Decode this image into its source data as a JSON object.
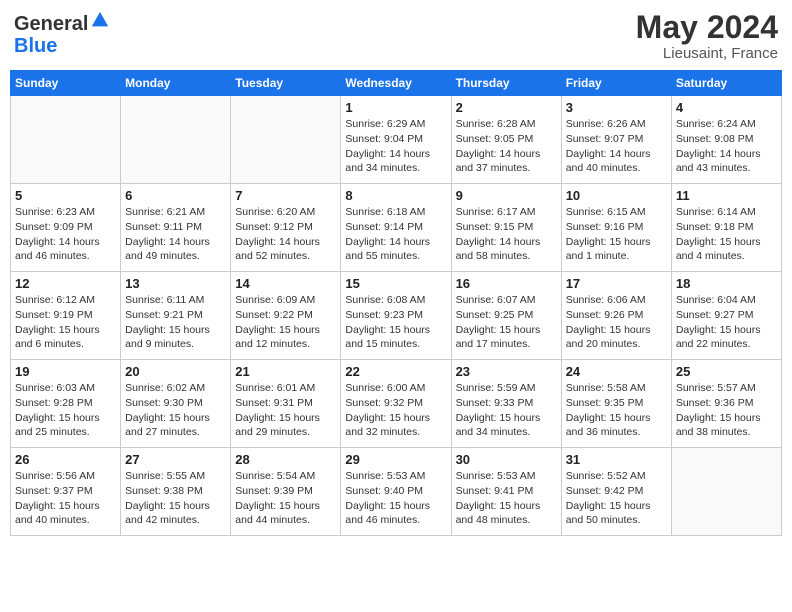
{
  "header": {
    "logo_general": "General",
    "logo_blue": "Blue",
    "month": "May 2024",
    "location": "Lieusaint, France"
  },
  "weekdays": [
    "Sunday",
    "Monday",
    "Tuesday",
    "Wednesday",
    "Thursday",
    "Friday",
    "Saturday"
  ],
  "weeks": [
    [
      {
        "day": "",
        "sunrise": "",
        "sunset": "",
        "daylight": ""
      },
      {
        "day": "",
        "sunrise": "",
        "sunset": "",
        "daylight": ""
      },
      {
        "day": "",
        "sunrise": "",
        "sunset": "",
        "daylight": ""
      },
      {
        "day": "1",
        "sunrise": "Sunrise: 6:29 AM",
        "sunset": "Sunset: 9:04 PM",
        "daylight": "Daylight: 14 hours and 34 minutes."
      },
      {
        "day": "2",
        "sunrise": "Sunrise: 6:28 AM",
        "sunset": "Sunset: 9:05 PM",
        "daylight": "Daylight: 14 hours and 37 minutes."
      },
      {
        "day": "3",
        "sunrise": "Sunrise: 6:26 AM",
        "sunset": "Sunset: 9:07 PM",
        "daylight": "Daylight: 14 hours and 40 minutes."
      },
      {
        "day": "4",
        "sunrise": "Sunrise: 6:24 AM",
        "sunset": "Sunset: 9:08 PM",
        "daylight": "Daylight: 14 hours and 43 minutes."
      }
    ],
    [
      {
        "day": "5",
        "sunrise": "Sunrise: 6:23 AM",
        "sunset": "Sunset: 9:09 PM",
        "daylight": "Daylight: 14 hours and 46 minutes."
      },
      {
        "day": "6",
        "sunrise": "Sunrise: 6:21 AM",
        "sunset": "Sunset: 9:11 PM",
        "daylight": "Daylight: 14 hours and 49 minutes."
      },
      {
        "day": "7",
        "sunrise": "Sunrise: 6:20 AM",
        "sunset": "Sunset: 9:12 PM",
        "daylight": "Daylight: 14 hours and 52 minutes."
      },
      {
        "day": "8",
        "sunrise": "Sunrise: 6:18 AM",
        "sunset": "Sunset: 9:14 PM",
        "daylight": "Daylight: 14 hours and 55 minutes."
      },
      {
        "day": "9",
        "sunrise": "Sunrise: 6:17 AM",
        "sunset": "Sunset: 9:15 PM",
        "daylight": "Daylight: 14 hours and 58 minutes."
      },
      {
        "day": "10",
        "sunrise": "Sunrise: 6:15 AM",
        "sunset": "Sunset: 9:16 PM",
        "daylight": "Daylight: 15 hours and 1 minute."
      },
      {
        "day": "11",
        "sunrise": "Sunrise: 6:14 AM",
        "sunset": "Sunset: 9:18 PM",
        "daylight": "Daylight: 15 hours and 4 minutes."
      }
    ],
    [
      {
        "day": "12",
        "sunrise": "Sunrise: 6:12 AM",
        "sunset": "Sunset: 9:19 PM",
        "daylight": "Daylight: 15 hours and 6 minutes."
      },
      {
        "day": "13",
        "sunrise": "Sunrise: 6:11 AM",
        "sunset": "Sunset: 9:21 PM",
        "daylight": "Daylight: 15 hours and 9 minutes."
      },
      {
        "day": "14",
        "sunrise": "Sunrise: 6:09 AM",
        "sunset": "Sunset: 9:22 PM",
        "daylight": "Daylight: 15 hours and 12 minutes."
      },
      {
        "day": "15",
        "sunrise": "Sunrise: 6:08 AM",
        "sunset": "Sunset: 9:23 PM",
        "daylight": "Daylight: 15 hours and 15 minutes."
      },
      {
        "day": "16",
        "sunrise": "Sunrise: 6:07 AM",
        "sunset": "Sunset: 9:25 PM",
        "daylight": "Daylight: 15 hours and 17 minutes."
      },
      {
        "day": "17",
        "sunrise": "Sunrise: 6:06 AM",
        "sunset": "Sunset: 9:26 PM",
        "daylight": "Daylight: 15 hours and 20 minutes."
      },
      {
        "day": "18",
        "sunrise": "Sunrise: 6:04 AM",
        "sunset": "Sunset: 9:27 PM",
        "daylight": "Daylight: 15 hours and 22 minutes."
      }
    ],
    [
      {
        "day": "19",
        "sunrise": "Sunrise: 6:03 AM",
        "sunset": "Sunset: 9:28 PM",
        "daylight": "Daylight: 15 hours and 25 minutes."
      },
      {
        "day": "20",
        "sunrise": "Sunrise: 6:02 AM",
        "sunset": "Sunset: 9:30 PM",
        "daylight": "Daylight: 15 hours and 27 minutes."
      },
      {
        "day": "21",
        "sunrise": "Sunrise: 6:01 AM",
        "sunset": "Sunset: 9:31 PM",
        "daylight": "Daylight: 15 hours and 29 minutes."
      },
      {
        "day": "22",
        "sunrise": "Sunrise: 6:00 AM",
        "sunset": "Sunset: 9:32 PM",
        "daylight": "Daylight: 15 hours and 32 minutes."
      },
      {
        "day": "23",
        "sunrise": "Sunrise: 5:59 AM",
        "sunset": "Sunset: 9:33 PM",
        "daylight": "Daylight: 15 hours and 34 minutes."
      },
      {
        "day": "24",
        "sunrise": "Sunrise: 5:58 AM",
        "sunset": "Sunset: 9:35 PM",
        "daylight": "Daylight: 15 hours and 36 minutes."
      },
      {
        "day": "25",
        "sunrise": "Sunrise: 5:57 AM",
        "sunset": "Sunset: 9:36 PM",
        "daylight": "Daylight: 15 hours and 38 minutes."
      }
    ],
    [
      {
        "day": "26",
        "sunrise": "Sunrise: 5:56 AM",
        "sunset": "Sunset: 9:37 PM",
        "daylight": "Daylight: 15 hours and 40 minutes."
      },
      {
        "day": "27",
        "sunrise": "Sunrise: 5:55 AM",
        "sunset": "Sunset: 9:38 PM",
        "daylight": "Daylight: 15 hours and 42 minutes."
      },
      {
        "day": "28",
        "sunrise": "Sunrise: 5:54 AM",
        "sunset": "Sunset: 9:39 PM",
        "daylight": "Daylight: 15 hours and 44 minutes."
      },
      {
        "day": "29",
        "sunrise": "Sunrise: 5:53 AM",
        "sunset": "Sunset: 9:40 PM",
        "daylight": "Daylight: 15 hours and 46 minutes."
      },
      {
        "day": "30",
        "sunrise": "Sunrise: 5:53 AM",
        "sunset": "Sunset: 9:41 PM",
        "daylight": "Daylight: 15 hours and 48 minutes."
      },
      {
        "day": "31",
        "sunrise": "Sunrise: 5:52 AM",
        "sunset": "Sunset: 9:42 PM",
        "daylight": "Daylight: 15 hours and 50 minutes."
      },
      {
        "day": "",
        "sunrise": "",
        "sunset": "",
        "daylight": ""
      }
    ]
  ]
}
